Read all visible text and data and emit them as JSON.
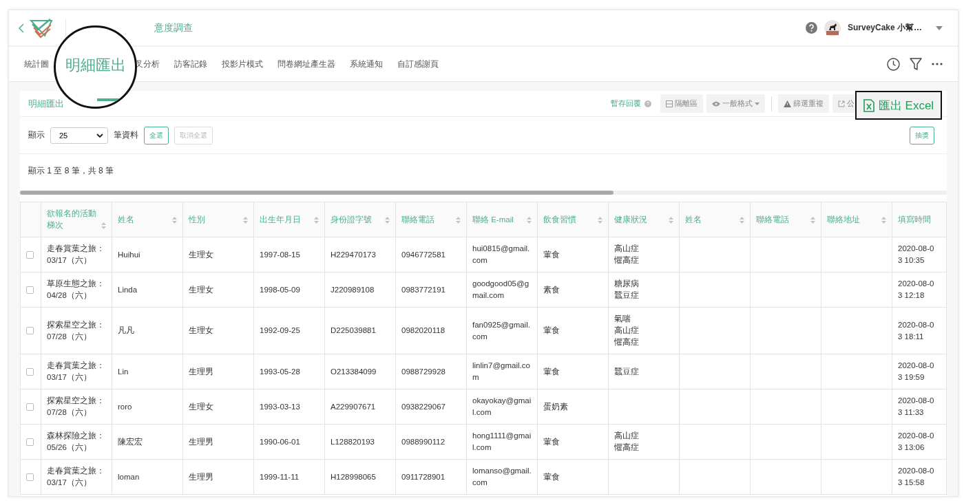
{
  "header": {
    "title": "意度調查",
    "user": "SurveyCake 小幫…"
  },
  "tabs": [
    {
      "label": "統計圖",
      "selected": false
    },
    {
      "label": "叉分析",
      "selected": false
    },
    {
      "label": "訪客記錄",
      "selected": false
    },
    {
      "label": "投影片模式",
      "selected": false
    },
    {
      "label": "問卷網址產生器",
      "selected": false
    },
    {
      "label": "系統通知",
      "selected": false
    },
    {
      "label": "自訂感謝頁",
      "selected": false
    }
  ],
  "magnifier": {
    "label": "明細匯出"
  },
  "card": {
    "title": "明細匯出",
    "toolbar": [
      {
        "kind": "save",
        "label": "暫存回覆"
      },
      {
        "kind": "quarantine",
        "label": "隔離區"
      },
      {
        "kind": "format",
        "label": "一般格式"
      },
      {
        "kind": "duplicates",
        "label": "篩選重複"
      },
      {
        "kind": "publish",
        "label": "公"
      }
    ],
    "export_button": {
      "label": "匯出 Excel"
    },
    "page_size": {
      "label_before": "顯示",
      "value": "25",
      "label_after": "筆資料"
    },
    "select_all": {
      "label": "全選",
      "disabled": false
    },
    "deselect_all": {
      "label": "取消全選",
      "disabled": true
    },
    "lottery": {
      "label": "抽獎"
    },
    "summary": "顯示 1 至 8 筆，共 8 筆"
  },
  "table": {
    "columns": [
      {
        "label": "欲報名的活動梯次",
        "sortable": true
      },
      {
        "label": "姓名",
        "sortable": true
      },
      {
        "label": "性別",
        "sortable": true
      },
      {
        "label": "出生年月日",
        "sortable": true
      },
      {
        "label": "身份證字號",
        "sortable": true
      },
      {
        "label": "聯絡電話",
        "sortable": true
      },
      {
        "label": "聯絡 E-mail",
        "sortable": true
      },
      {
        "label": "飲食習慣",
        "sortable": true
      },
      {
        "label": "健康狀況",
        "sortable": true
      },
      {
        "label": "姓名",
        "sortable": true
      },
      {
        "label": "聯絡電話",
        "sortable": true
      },
      {
        "label": "聯絡地址",
        "sortable": true
      },
      {
        "label": "填寫時間",
        "sortable": false
      }
    ],
    "rows": [
      {
        "checked": false,
        "event": "走春賞葉之旅：03/17（六）",
        "name": "Huihui",
        "gender": "生理女",
        "birthdate": "1997-08-15",
        "id_number": "H229470173",
        "phone": "0946772581",
        "email": "hui0815@gmail.com",
        "diet": "葷食",
        "health": [
          "高山症",
          "懼高症"
        ],
        "submitted_at": "2020-08-03 10:35"
      },
      {
        "checked": false,
        "event": "草原生態之旅：04/28（六）",
        "name": "Linda",
        "gender": "生理女",
        "birthdate": "1998-05-09",
        "id_number": "J220989108",
        "phone": "0983772191",
        "email": "goodgood05@gmail.com",
        "diet": "素食",
        "health": [
          "糖尿病",
          "蠶豆症"
        ],
        "submitted_at": "2020-08-03 12:18"
      },
      {
        "checked": false,
        "event": "探索星空之旅：07/28（六）",
        "name": "凡凡",
        "gender": "生理女",
        "birthdate": "1992-09-25",
        "id_number": "D225039881",
        "phone": "0982020118",
        "email": "fan0925@gmail.com",
        "diet": "葷食",
        "health": [
          "氣喘",
          "高山症",
          "懼高症"
        ],
        "submitted_at": "2020-08-03 18:11"
      },
      {
        "checked": false,
        "event": "走春賞葉之旅：03/17（六）",
        "name": "Lin",
        "gender": "生理男",
        "birthdate": "1993-05-28",
        "id_number": "O213384099",
        "phone": "0988729928",
        "email": "linlin7@gmail.com",
        "diet": "葷食",
        "health": [
          "蠶豆症"
        ],
        "submitted_at": "2020-08-03 19:59"
      },
      {
        "checked": false,
        "event": "探索星空之旅：07/28（六）",
        "name": "roro",
        "gender": "生理女",
        "birthdate": "1993-03-13",
        "id_number": "A229907671",
        "phone": "0938229067",
        "email": "okayokay@gmail.com",
        "diet": "蛋奶素",
        "submitted_at": "2020-08-03 11:33"
      },
      {
        "checked": false,
        "event": "森林探險之旅：05/26（六）",
        "name": "陳宏宏",
        "gender": "生理男",
        "birthdate": "1990-06-01",
        "id_number": "L128820193",
        "phone": "0988990112",
        "email": "hong1111@gmail.com",
        "diet": "葷食",
        "health": [
          "高山症",
          "懼高症"
        ],
        "submitted_at": "2020-08-03 13:06"
      },
      {
        "checked": false,
        "event": "走春賞葉之旅：03/17（六）",
        "name": "loman",
        "gender": "生理男",
        "birthdate": "1999-11-11",
        "id_number": "H128998065",
        "phone": "0911728901",
        "email": "lomanso@gmail.com",
        "diet": "葷食",
        "submitted_at": "2020-08-03 15:58"
      }
    ]
  }
}
